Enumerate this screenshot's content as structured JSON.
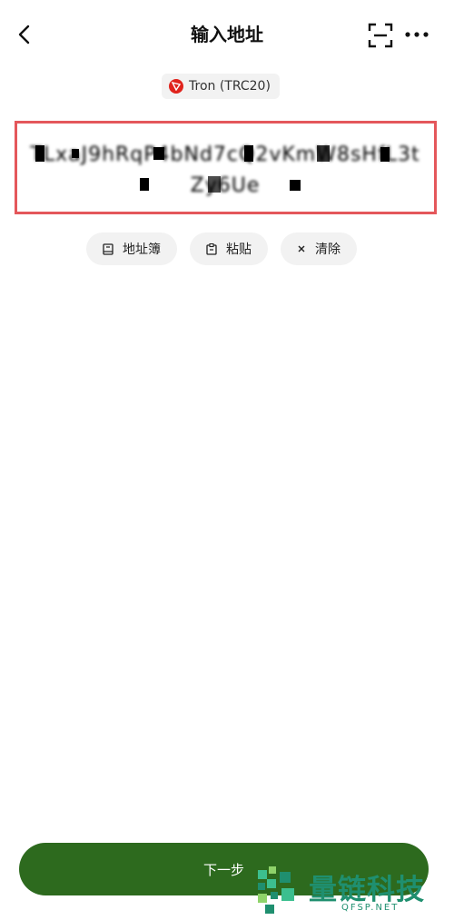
{
  "header": {
    "title": "输入地址"
  },
  "network": {
    "label": "Tron (TRC20)"
  },
  "address": {
    "value": "TLxaJ9hRqP4bNd7cQ2vKmW8sHfL3tZy6Ue"
  },
  "actions": [
    {
      "label": "地址簿",
      "icon": "address-book-icon"
    },
    {
      "label": "粘贴",
      "icon": "clipboard-icon"
    },
    {
      "label": "清除",
      "icon": "close-icon"
    }
  ],
  "footer": {
    "next_label": "下一步"
  },
  "watermark": {
    "brand": "量链科技",
    "domain": "QFSP.NET"
  },
  "colors": {
    "primary": "#2d6a1e",
    "highlight_border": "#e4575b",
    "tron": "#e0231c",
    "watermark": "#1f8f6f"
  }
}
